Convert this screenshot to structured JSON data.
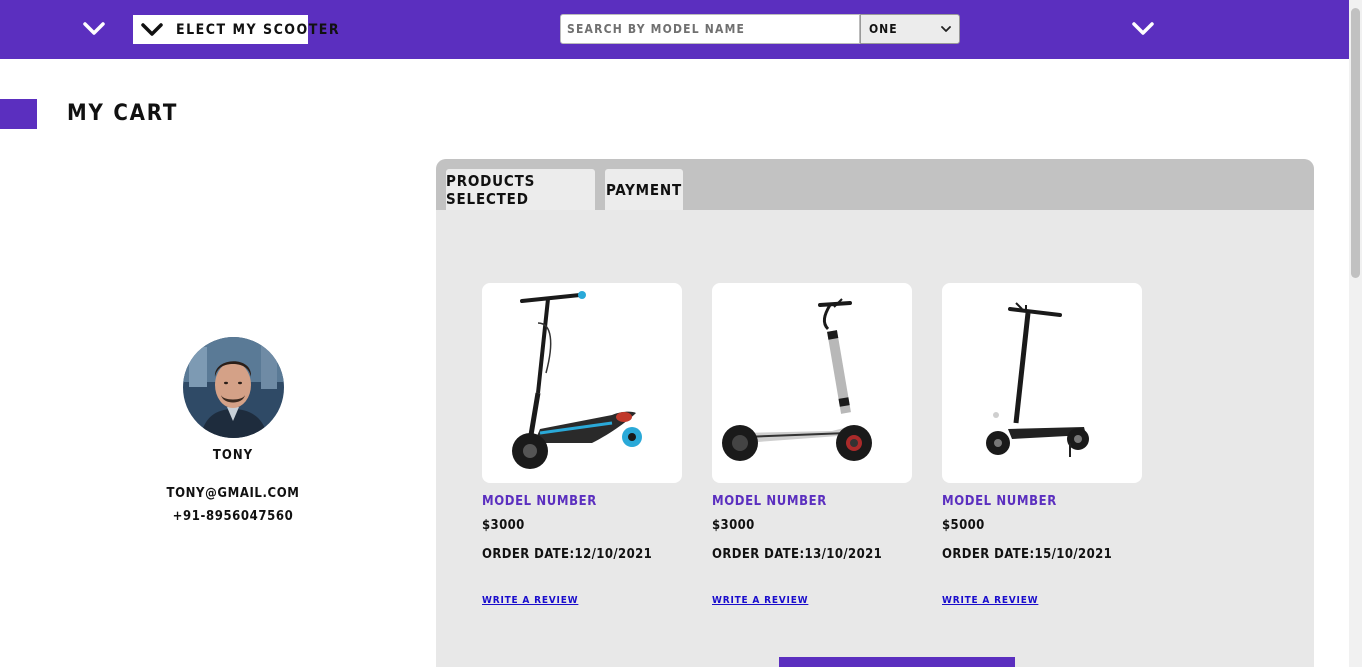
{
  "header": {
    "brand": "ELECT MY SCOOTER",
    "search_placeholder": "SEARCH BY MODEL NAME",
    "filter_selected": "ONE",
    "left_toggle_icon": "chevron-down-icon",
    "right_toggle_icon": "chevron-down-icon"
  },
  "page": {
    "title": "MY CART"
  },
  "profile": {
    "name": "TONY",
    "email": "TONY@GMAIL.COM",
    "phone": "+91-8956047560"
  },
  "tabs": [
    {
      "label": "PRODUCTS SELECTED",
      "active": true
    },
    {
      "label": "PAYMENT",
      "active": false
    }
  ],
  "products": [
    {
      "model": "MODEL NUMBER",
      "price": "$3000",
      "order_date": "ORDER DATE:12/10/2021",
      "review": "WRITE A REVIEW"
    },
    {
      "model": "MODEL NUMBER",
      "price": "$3000",
      "order_date": "ORDER DATE:13/10/2021",
      "review": "WRITE A REVIEW"
    },
    {
      "model": "MODEL NUMBER",
      "price": "$5000",
      "order_date": "ORDER DATE:15/10/2021",
      "review": "WRITE A REVIEW"
    }
  ],
  "colors": {
    "brand": "#5b2fbf",
    "panel": "#e8e8e8",
    "tabbar": "#c2c2c2",
    "link": "#1a0dcc"
  }
}
